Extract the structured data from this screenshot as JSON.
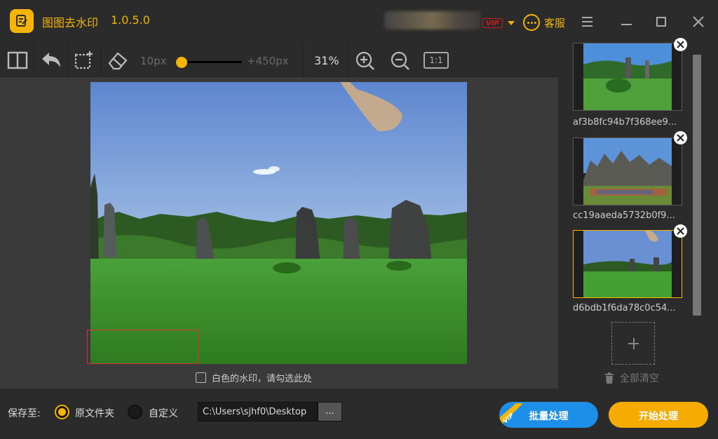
{
  "app": {
    "title": "图图去水印",
    "version": "1.0.5.0",
    "vip_badge": "VIP",
    "customer_service": "客服"
  },
  "toolbar": {
    "brush_min": "10px",
    "brush_max": "+450px",
    "brush_level": 0.08,
    "zoom": "31%",
    "actual_size": "1:1"
  },
  "canvas": {
    "white_watermark_option": "白色的水印，请勾选此处",
    "white_watermark_checked": false
  },
  "files": [
    {
      "name": "af3b8fc94b7f368ee9..."
    },
    {
      "name": "cc19aaeda5732b0f9..."
    },
    {
      "name": "d6bdb1f6da78c0c54..."
    }
  ],
  "side": {
    "clear_all": "全部清空"
  },
  "bottom": {
    "save_to": "保存至:",
    "option_original": "原文件夹",
    "option_custom": "自定义",
    "path_value": "C:\\Users\\sjhf0\\Desktop",
    "browse": "...",
    "batch": "批量处理",
    "batch_vip": "VIP",
    "start": "开始处理"
  },
  "colors": {
    "accent": "#f5b400",
    "batch_blue": "#1e8fe8",
    "start_orange": "#f5ab00",
    "selection_red": "#d33333"
  }
}
